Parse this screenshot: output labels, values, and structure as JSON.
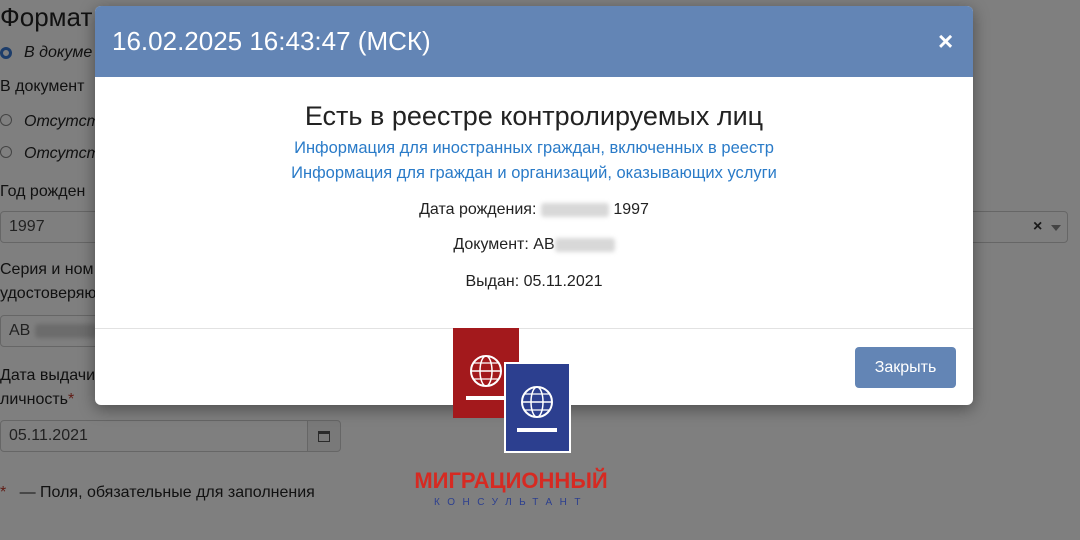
{
  "background_form": {
    "section_title": "Формат",
    "radio_option_1": "В докуме",
    "document_label": "В документ",
    "radio_option_2": "Отсутству",
    "radio_option_3": "Отсутству",
    "birth_year_label": "Год рожден",
    "birth_year_value": "1997",
    "doc_series_label_1": "Серия и ном",
    "doc_series_label_2": "удостоверяю",
    "doc_series_prefix": "АВ",
    "issue_date_label_1": "Дата выдачи",
    "issue_date_label_2": "личность",
    "required_mark": "*",
    "issue_date_value": "05.11.2021",
    "required_note": "— Поля, обязательные для заполнения",
    "clear_symbol": "×"
  },
  "modal": {
    "title": "16.02.2025 16:43:47 (МСК)",
    "close_symbol": "×",
    "status_heading": "Есть в реестре контролируемых лиц",
    "link_1": "Информация для иностранных граждан, включенных в реестр",
    "link_2": "Информация для граждан и организаций, оказывающих услуги",
    "birth_label": "Дата рождения:",
    "birth_year": "1997",
    "document_label": "Документ:",
    "document_prefix": "АВ",
    "issued_label": "Выдан:",
    "issued_date": "05.11.2021",
    "close_button": "Закрыть"
  },
  "logo": {
    "line_1": "МИГРАЦИОННЫЙ",
    "line_2": "КОНСУЛЬТАНТ"
  },
  "colors": {
    "header": "#6385b5",
    "link": "#2a7bc8",
    "passport_red": "#a3191c",
    "passport_blue": "#2c3f8f",
    "logo_red": "#d62a22"
  }
}
